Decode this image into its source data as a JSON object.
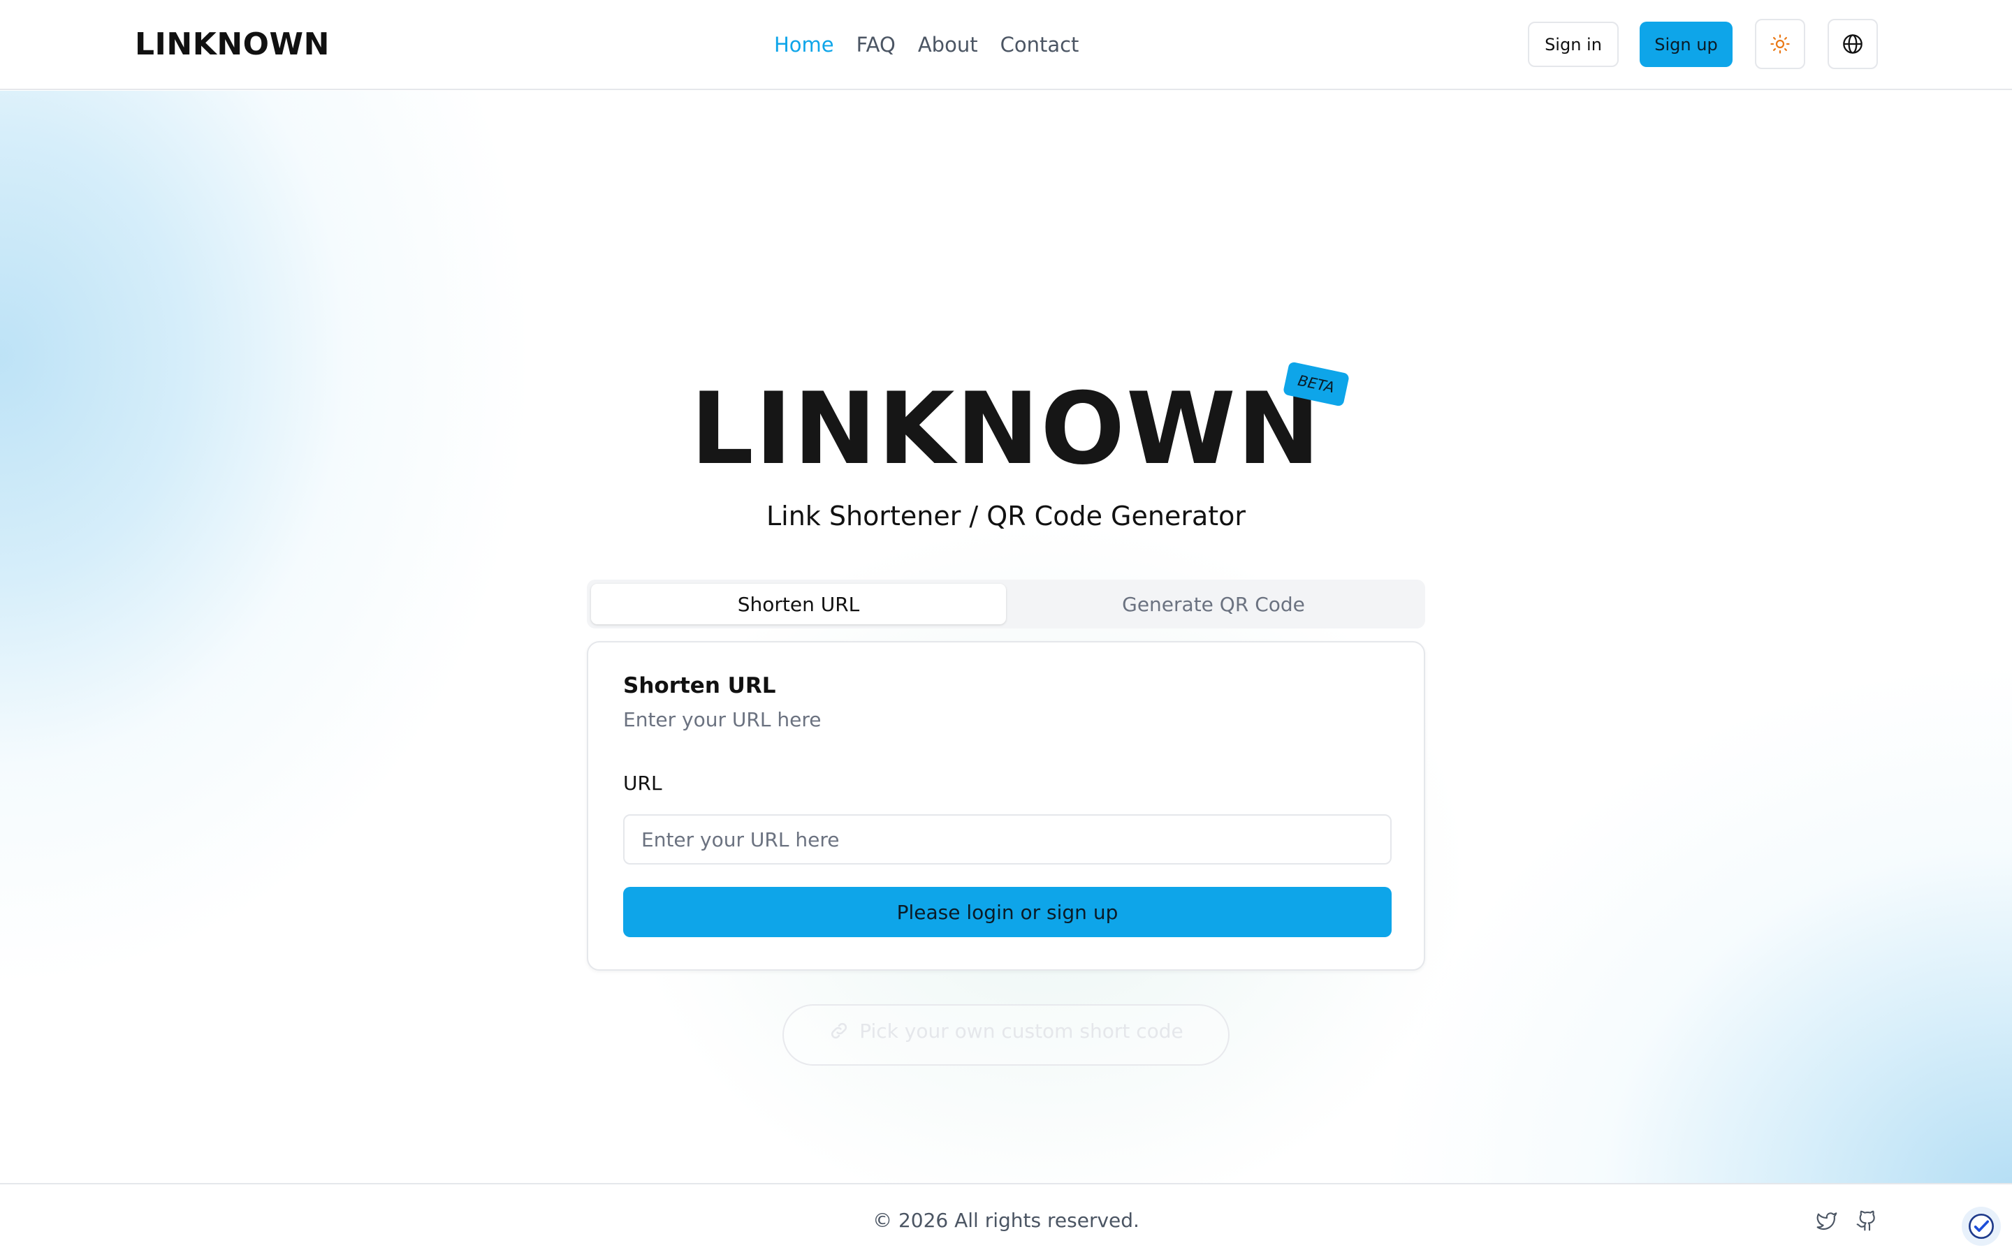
{
  "header": {
    "logo": "LINKNOWN",
    "nav": [
      {
        "label": "Home",
        "active": true
      },
      {
        "label": "FAQ",
        "active": false
      },
      {
        "label": "About",
        "active": false
      },
      {
        "label": "Contact",
        "active": false
      }
    ],
    "signin_label": "Sign in",
    "signup_label": "Sign up",
    "theme_icon": "sun-icon",
    "language_icon": "globe-icon"
  },
  "hero": {
    "title": "LINKNOWN",
    "badge": "BETA",
    "subtitle": "Link Shortener / QR Code Generator"
  },
  "tabs": [
    {
      "label": "Shorten URL",
      "active": true
    },
    {
      "label": "Generate QR Code",
      "active": false
    }
  ],
  "card": {
    "title": "Shorten URL",
    "description": "Enter your URL here",
    "field_label": "URL",
    "input_placeholder": "Enter your URL here",
    "input_value": "",
    "submit_label": "Please login or sign up"
  },
  "custom_code": {
    "label": "Pick your own custom short code",
    "icon": "link-icon"
  },
  "footer": {
    "copyright": "© 2026 All rights reserved.",
    "icons": [
      "twitter-icon",
      "github-icon"
    ]
  },
  "colors": {
    "accent": "#0ea5e9",
    "text": "#111111",
    "muted": "#6b7280",
    "border": "#e5e7eb"
  }
}
